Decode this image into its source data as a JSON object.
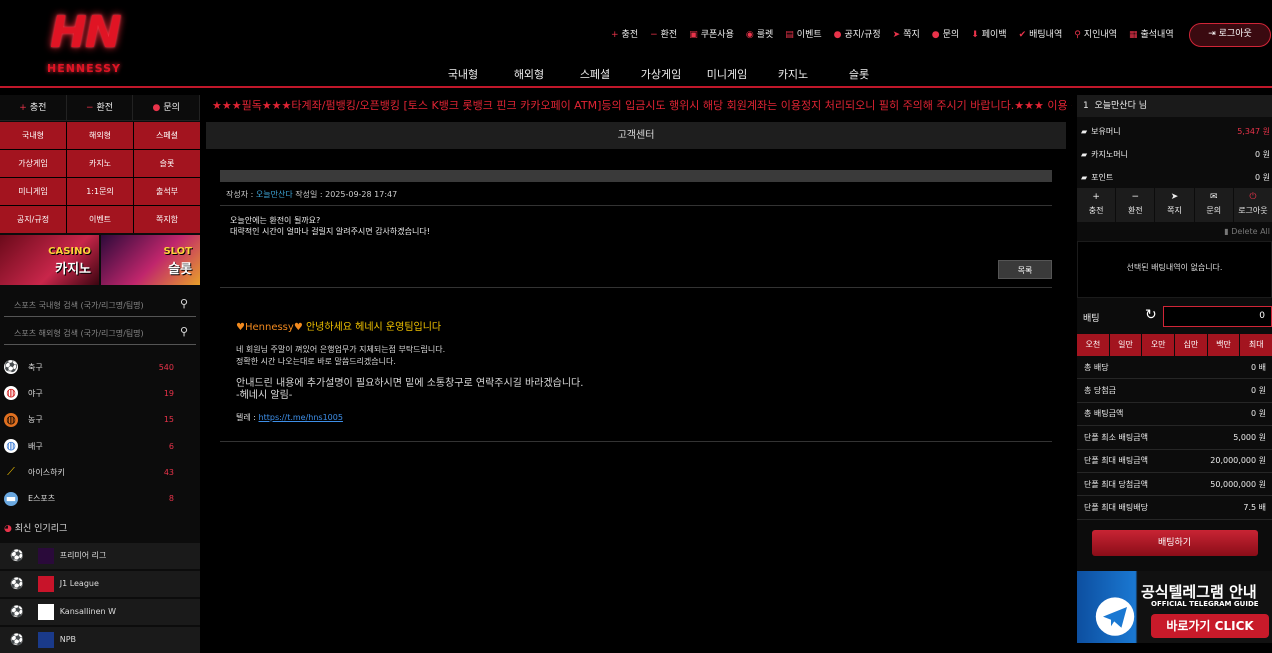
{
  "brand": {
    "logo": "HN",
    "name": "HENNESSY"
  },
  "topnav": [
    {
      "icon": "plus-icon",
      "glyph": "+",
      "label": "충전"
    },
    {
      "icon": "minus-icon",
      "glyph": "−",
      "label": "환전"
    },
    {
      "icon": "coupon-icon",
      "glyph": "▣",
      "label": "쿠폰사용"
    },
    {
      "icon": "roulette-icon",
      "glyph": "◉",
      "label": "룰렛"
    },
    {
      "icon": "event-icon",
      "glyph": "▤",
      "label": "이벤트"
    },
    {
      "icon": "notice-icon",
      "glyph": "●",
      "label": "공지/규정"
    },
    {
      "icon": "message-icon",
      "glyph": "➤",
      "label": "쪽지"
    },
    {
      "icon": "question-icon",
      "glyph": "●",
      "label": "문의"
    },
    {
      "icon": "paybook-icon",
      "glyph": "⬇",
      "label": "페이백"
    },
    {
      "icon": "check-icon",
      "glyph": "✔",
      "label": "배팅내역"
    },
    {
      "icon": "point-icon",
      "glyph": "⚲",
      "label": "지인내역"
    },
    {
      "icon": "calendar-icon",
      "glyph": "▦",
      "label": "출석내역"
    }
  ],
  "logout_label": "로그아웃",
  "mainnav": [
    "국내형",
    "해외형",
    "스페셜",
    "가상게임",
    "미니게임",
    "카지노",
    "슬롯"
  ],
  "left": {
    "quick": [
      {
        "glyph": "+",
        "label": "충전"
      },
      {
        "glyph": "−",
        "label": "환전"
      },
      {
        "glyph": "●",
        "label": "문의"
      }
    ],
    "grid": [
      "국내형",
      "해외형",
      "스페셜",
      "가상게임",
      "카지노",
      "슬롯",
      "미니게임",
      "1:1문의",
      "출석부",
      "공지/규정",
      "이벤트",
      "쪽지함"
    ],
    "banners": [
      {
        "top": "CASINO",
        "bottom": "카지노"
      },
      {
        "top": "SLOT",
        "bottom": "슬롯"
      }
    ],
    "search1": "스포츠 국내형 검색 (국가/리그명/팀명)",
    "search2": "스포츠 해외형 검색 (국가/리그명/팀명)",
    "sports": [
      {
        "icon": "soccer-icon",
        "label": "축구",
        "count": "540",
        "bg": "#fff",
        "fg": "#000",
        "glyph": "⚽"
      },
      {
        "icon": "baseball-icon",
        "label": "야구",
        "count": "19",
        "bg": "#fff",
        "fg": "#c00",
        "glyph": "◍"
      },
      {
        "icon": "basketball-icon",
        "label": "농구",
        "count": "15",
        "bg": "#e07020",
        "fg": "#000",
        "glyph": "◍"
      },
      {
        "icon": "volleyball-icon",
        "label": "배구",
        "count": "6",
        "bg": "#fff",
        "fg": "#2a6fd0",
        "glyph": "◍"
      },
      {
        "icon": "hockey-icon",
        "label": "아이스하키",
        "count": "43",
        "bg": "transparent",
        "fg": "#f0c000",
        "glyph": "⟋"
      },
      {
        "icon": "esports-icon",
        "label": "E스포츠",
        "count": "8",
        "bg": "#6aa8e0",
        "fg": "#fff",
        "glyph": "▬"
      }
    ],
    "popular_title": "최신 인기리그",
    "leagues": [
      {
        "label": "프리미어 리그",
        "color": "#2a0a3a"
      },
      {
        "label": "J1 League",
        "color": "#c8142a"
      },
      {
        "label": "Kansallinen W",
        "color": "#fff"
      },
      {
        "label": "NPB",
        "color": "#1a3a8a"
      }
    ]
  },
  "ticker": "★★★필독★★★타계좌/펌뱅킹/오픈뱅킹 [토스 K뱅크 롯뱅크 핀크 카카오페이 ATM]등의 입금시도 행위시 해당 회원계좌는 이용정지 처리되오니 필히 주의해 주시기 바랍니다.★★★ 이용 전 공지사항",
  "center": {
    "title": "고객센터",
    "author_label": "작성자 :",
    "author": "오늘만산다",
    "date_label": "작성일 :",
    "date": "2025-09-28 17:47",
    "question": [
      "오늘안에는 환전이 될까요?",
      "대략적인 시간이 얼마나 걸릴지 알려주시면 감사하겠습니다!"
    ],
    "list_button": "목록",
    "answer": {
      "heading": "Hennessy",
      "heading_rest": " 안녕하세요 헤네시 운영팀입니다",
      "lines": [
        "네 회원님 주말이 껴있어 은행업무가 지체되는점 부탁드립니다.",
        "정확한 시간 나오는대로 바로 말씀드리겠습니다."
      ],
      "main": [
        "안내드린 내용에 추가설명이 필요하시면 밑에 소통창구로 연락주시길 바라겠습니다.",
        "-헤네시 알림-"
      ],
      "tele_label": "텔레 :",
      "tele_link": "https://t.me/hns1005"
    }
  },
  "right": {
    "user_no": "1",
    "user": "오늘만산다 님",
    "money": [
      {
        "icon": "wallet-icon",
        "label": "보유머니",
        "value": "5,347 원",
        "vcolor": "#e8334a"
      },
      {
        "icon": "casino-money-icon",
        "label": "카지노머니",
        "value": "0 원",
        "vcolor": "#eee"
      },
      {
        "icon": "point-icon",
        "label": "포인트",
        "value": "0 원",
        "vcolor": "#eee"
      }
    ],
    "buttons": [
      {
        "glyph": "+",
        "label": "충전"
      },
      {
        "glyph": "−",
        "label": "환전"
      },
      {
        "glyph": "➤",
        "label": "쪽지"
      },
      {
        "glyph": "✉",
        "label": "문의"
      },
      {
        "glyph": "⏻",
        "label": "로그아웃"
      }
    ],
    "delete_all": "Delete All",
    "no_bet": "선택된 배팅내역이 없습니다.",
    "bet_label": "배팅",
    "bet_value": "0",
    "amounts": [
      "오천",
      "일만",
      "오만",
      "십만",
      "백만",
      "최대"
    ],
    "stats": [
      {
        "label": "총 배당",
        "value": "0 배"
      },
      {
        "label": "총 당첨금",
        "value": "0 원"
      },
      {
        "label": "총 배팅금액",
        "value": "0 원"
      },
      {
        "label": "단폴 최소 배팅금액",
        "value": "5,000 원"
      },
      {
        "label": "단폴 최대 배팅금액",
        "value": "20,000,000 원"
      },
      {
        "label": "단폴 최대 당첨금액",
        "value": "50,000,000 원"
      },
      {
        "label": "단폴 최대 배팅배당",
        "value": "7.5 배"
      }
    ],
    "bet_button": "배팅하기",
    "telegram": {
      "title": "공식텔레그램 안내",
      "sub": "OFFICIAL TELEGRAM GUIDE",
      "cta": "바로가기 CLICK"
    }
  }
}
